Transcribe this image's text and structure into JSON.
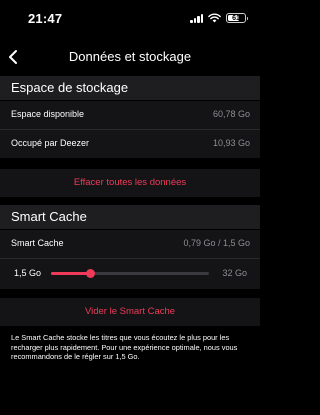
{
  "status_bar": {
    "time": "21:47",
    "battery_level": "61"
  },
  "nav": {
    "title": "Données et stockage",
    "back_icon": "chevron-left-icon"
  },
  "storage": {
    "header": "Espace de stockage",
    "rows": [
      {
        "label": "Espace disponible",
        "value": "60,78 Go"
      },
      {
        "label": "Occupé par Deezer",
        "value": "10,93 Go"
      }
    ],
    "clear_all_label": "Effacer toutes les données"
  },
  "smart_cache": {
    "header": "Smart Cache",
    "row_label": "Smart Cache",
    "row_value": "0,79 Go / 1,5 Go",
    "slider_min_label": "1,5 Go",
    "slider_max_label": "32 Go",
    "slider_fraction": 0.25,
    "clear_label": "Vider le Smart Cache",
    "description": "Le Smart Cache stocke les titres que vous écoutez le plus pour les recharger plus rapidement. Pour une expérience optimale, nous vous recommandons de le régler sur 1,5 Go."
  },
  "colors": {
    "accent": "#ef3b5a",
    "background": "#000000",
    "section_bg": "#1e1e21",
    "row_bg": "#141416",
    "secondary_text": "#8e8e93"
  }
}
